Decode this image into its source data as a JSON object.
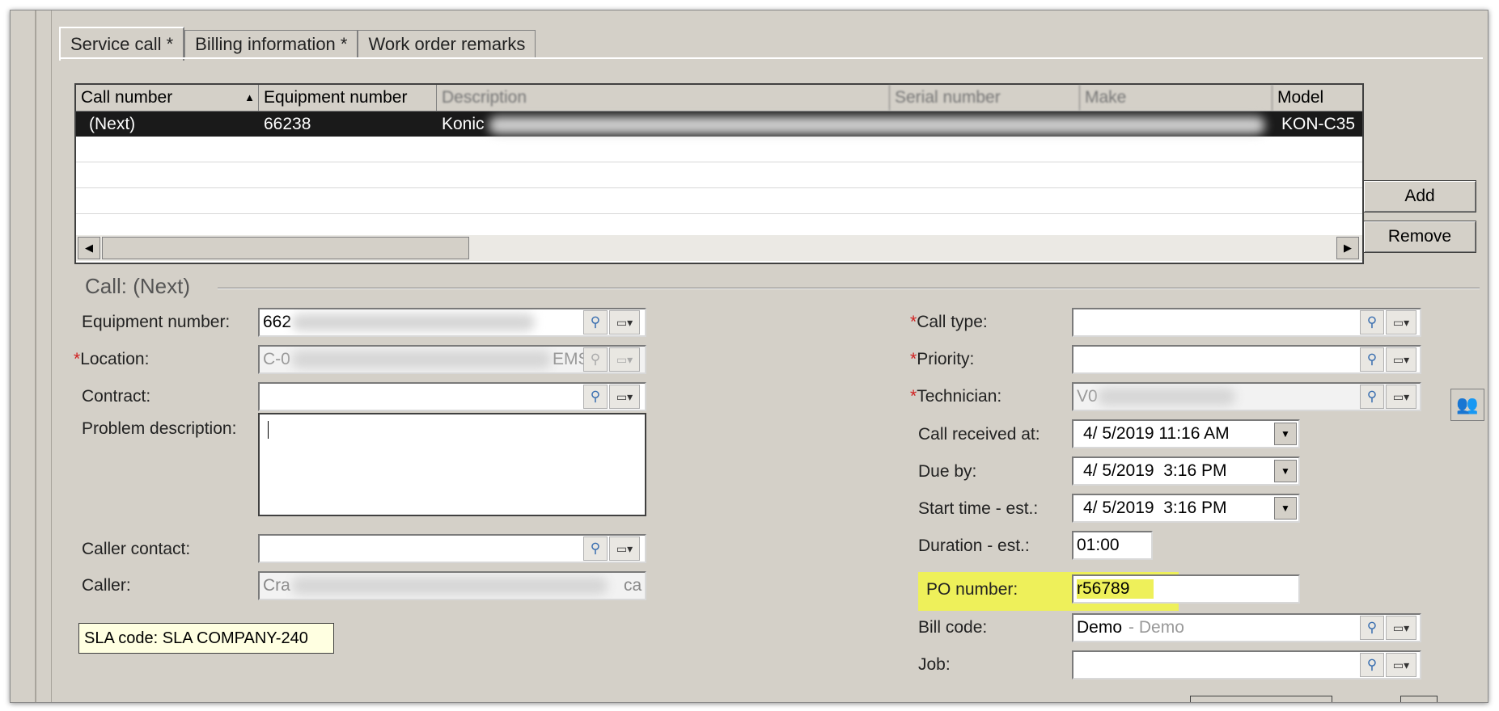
{
  "tabs": [
    {
      "label": "Service call *"
    },
    {
      "label": "Billing information *"
    },
    {
      "label": "Work order remarks"
    }
  ],
  "grid": {
    "columns": [
      "Call number",
      "Equipment number",
      "Description",
      "Serial number",
      "Make",
      "Model"
    ],
    "rows": [
      {
        "call_number": "(Next)",
        "equipment_number": "66238",
        "description": "Konic",
        "model": "KON-C35"
      }
    ]
  },
  "buttons": {
    "add": "Add",
    "remove": "Remove"
  },
  "call": {
    "title": "Call: (Next)",
    "equipment_label": "Equipment number:",
    "equipment_value": "662",
    "location_label": "Location:",
    "location_value_start": "C-0",
    "location_value_end": "EMS",
    "contract_label": "Contract:",
    "problem_label": "Problem description:",
    "caller_contact_label": "Caller contact:",
    "caller_label": "Caller:",
    "caller_value_start": "Cra",
    "caller_value_end": "ca",
    "sla": "SLA code: SLA COMPANY-240",
    "call_type_label": "Call type:",
    "priority_label": "Priority:",
    "technician_label": "Technician:",
    "technician_value": "V0",
    "received_label": "Call received at:",
    "received_value": "4/ 5/2019 11:16 AM",
    "due_label": "Due by:",
    "due_value": "4/ 5/2019  3:16 PM",
    "start_label": "Start time - est.:",
    "start_value": "4/ 5/2019  3:16 PM",
    "duration_label": "Duration - est.:",
    "duration_value": "01:00",
    "po_label": "PO number:",
    "po_value": "r56789",
    "bill_label": "Bill code:",
    "bill_value": "Demo",
    "bill_desc": "- Demo",
    "job_label": "Job:"
  },
  "colors": {
    "highlight": "#eef05a",
    "selected_row": "#1a1a1a",
    "required": "#d02020"
  }
}
